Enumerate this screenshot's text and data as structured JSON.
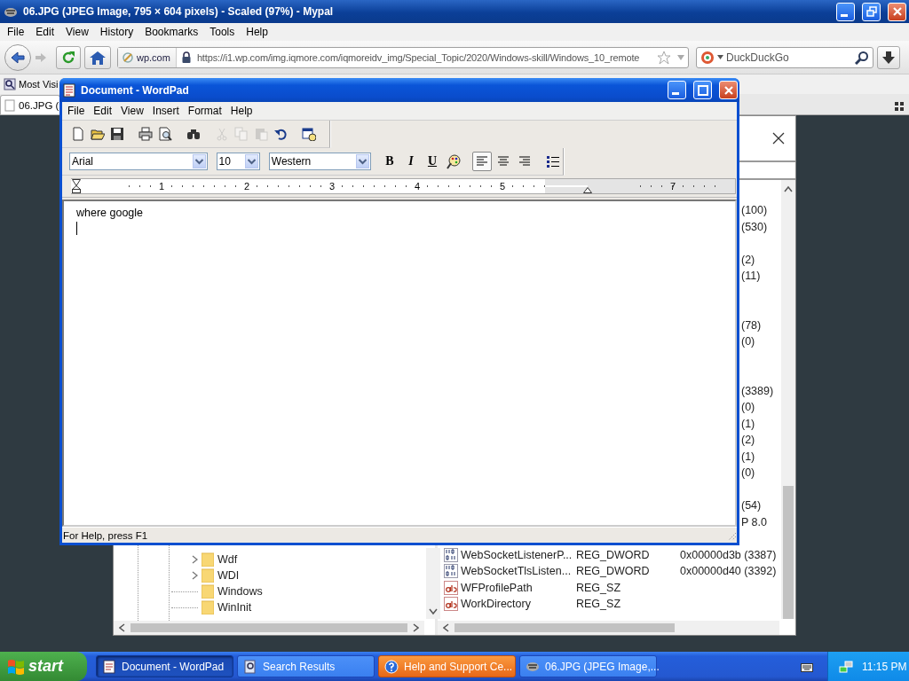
{
  "browser": {
    "title": "06.JPG (JPEG Image, 795 × 604 pixels) - Scaled (97%) - Mypal",
    "menu": [
      "File",
      "Edit",
      "View",
      "History",
      "Bookmarks",
      "Tools",
      "Help"
    ],
    "identity": "wp.com",
    "url": "https://i1.wp.com/img.iqmore.com/iqmoreidv_img/Special_Topic/2020/Windows-skill/Windows_10_remote",
    "search_placeholder": "DuckDuckGo",
    "bookmarks": [
      "Most Visi"
    ],
    "tabs": [
      {
        "label": "06.JPG (",
        "selected": true
      }
    ]
  },
  "image": {
    "list_rows_upper": [
      {
        "kind": "value",
        "data": "(100)"
      },
      {
        "kind": "value",
        "data": "(530)"
      },
      {
        "kind": "blank"
      },
      {
        "kind": "value",
        "data": "(2)"
      },
      {
        "kind": "value",
        "data": "(11)"
      },
      {
        "kind": "blank"
      },
      {
        "kind": "blank"
      },
      {
        "kind": "value",
        "data": "(78)"
      },
      {
        "kind": "value",
        "data": "(0)"
      },
      {
        "kind": "blank"
      },
      {
        "kind": "blank"
      },
      {
        "kind": "value",
        "data": "(3389)"
      },
      {
        "kind": "value",
        "data": "(0)"
      },
      {
        "kind": "value",
        "data": "(1)"
      },
      {
        "kind": "value",
        "data": "(2)"
      },
      {
        "kind": "value",
        "data": "(1)"
      },
      {
        "kind": "value",
        "data": "(0)"
      },
      {
        "kind": "blank"
      },
      {
        "kind": "value",
        "data": "(54)"
      },
      {
        "kind": "value",
        "data": "P 8.0"
      }
    ],
    "list_rows": [
      {
        "kind": "dword",
        "name": "WebSocketListenerP...",
        "type": "REG_DWORD",
        "data": "0x00000d3b (3387)"
      },
      {
        "kind": "dword",
        "name": "WebSocketTlsListen...",
        "type": "REG_DWORD",
        "data": "0x00000d40 (3392)"
      },
      {
        "kind": "sz",
        "name": "WFProfilePath",
        "type": "REG_SZ"
      },
      {
        "kind": "sz",
        "name": "WorkDirectory",
        "type": "REG_SZ"
      }
    ],
    "tree": [
      {
        "label": "Wdf",
        "expandable": true
      },
      {
        "label": "WDI",
        "expandable": true
      },
      {
        "label": "Windows",
        "expandable": false
      },
      {
        "label": "WinInit",
        "expandable": false
      }
    ]
  },
  "wordpad": {
    "title": "Document - WordPad",
    "menu": [
      "File",
      "Edit",
      "View",
      "Insert",
      "Format",
      "Help"
    ],
    "toolbar": [
      {
        "kind": "new",
        "disabled": false
      },
      {
        "kind": "open",
        "disabled": false
      },
      {
        "kind": "save",
        "disabled": false
      },
      {
        "kind": "print",
        "disabled": false
      },
      {
        "kind": "preview",
        "disabled": false
      },
      {
        "kind": "find",
        "disabled": false
      },
      {
        "kind": "cut",
        "disabled": true
      },
      {
        "kind": "copy",
        "disabled": true
      },
      {
        "kind": "paste",
        "disabled": true
      },
      {
        "kind": "undo",
        "disabled": false
      },
      {
        "kind": "datetime",
        "disabled": false
      }
    ],
    "font": "Arial",
    "size": "10",
    "script": "Western",
    "styles": [
      {
        "kind": "bold",
        "label": "B"
      },
      {
        "kind": "italic",
        "label": "I"
      },
      {
        "kind": "underline",
        "label": "U"
      }
    ],
    "align": [
      {
        "kind": "left",
        "selected": true
      },
      {
        "kind": "center",
        "selected": false
      },
      {
        "kind": "right",
        "selected": false
      }
    ],
    "ruler": [
      {
        "kind": "number",
        "label": "1"
      },
      {
        "kind": "number",
        "label": "2"
      },
      {
        "kind": "number",
        "label": "3"
      },
      {
        "kind": "number",
        "label": "4"
      },
      {
        "kind": "number",
        "label": "5"
      },
      {
        "kind": "indent"
      },
      {
        "kind": "number",
        "label": "7"
      }
    ],
    "text": "where google",
    "status": "For Help, press F1"
  },
  "taskbar": {
    "start": "start",
    "tasks": [
      {
        "kind": "wordpad",
        "label": "Document - WordPad",
        "selected": true,
        "flashing": false
      },
      {
        "kind": "search",
        "label": "Search Results",
        "selected": false,
        "flashing": false
      },
      {
        "kind": "help",
        "label": "Help and Support Ce...",
        "selected": false,
        "flashing": true
      },
      {
        "kind": "browser",
        "label": "06.JPG (JPEG Image,...",
        "selected": false,
        "flashing": false
      }
    ],
    "clock": "11:15 PM"
  }
}
